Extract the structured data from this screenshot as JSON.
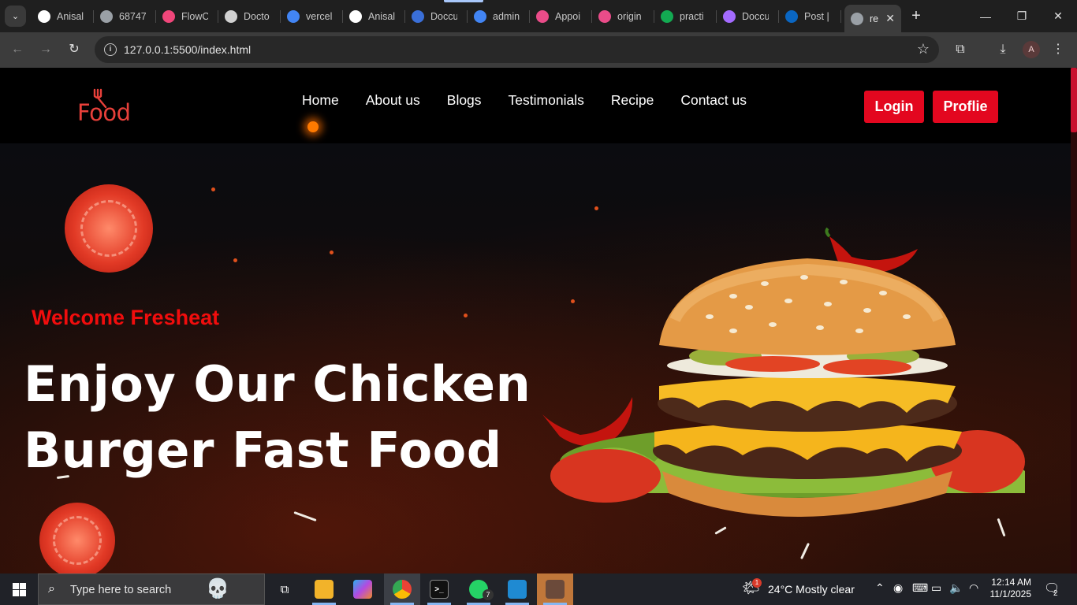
{
  "browser": {
    "tabs": [
      {
        "title": "Anisal",
        "icon": "github-icon",
        "color": "#ffffff"
      },
      {
        "title": "68747",
        "icon": "globe-icon",
        "color": "#9aa0a6"
      },
      {
        "title": "FlowC",
        "icon": "flowcv-icon",
        "color": "#f0467a"
      },
      {
        "title": "Docto",
        "icon": "chatgpt-icon",
        "color": "#d0d0d0"
      },
      {
        "title": "vercel",
        "icon": "google-icon",
        "color": "#4285f4"
      },
      {
        "title": "Anisal",
        "icon": "github-icon",
        "color": "#ffffff"
      },
      {
        "title": "Doccu",
        "icon": "doccure-icon",
        "color": "#3a6fd8"
      },
      {
        "title": "admin",
        "icon": "google-icon",
        "color": "#4285f4"
      },
      {
        "title": "Appoi",
        "icon": "dribbble-icon",
        "color": "#ea4c89"
      },
      {
        "title": "origin",
        "icon": "dribbble-icon",
        "color": "#ea4c89"
      },
      {
        "title": "practi",
        "icon": "mongodb-icon",
        "color": "#13aa52"
      },
      {
        "title": "Doccu",
        "icon": "vite-icon",
        "color": "#a46bff"
      },
      {
        "title": "Post |",
        "icon": "linkedin-icon",
        "color": "#0a66c2"
      }
    ],
    "active_tab": {
      "title": "re",
      "icon": "globe-icon"
    },
    "url": "127.0.0.1:5500/index.html",
    "profile_initial": "A"
  },
  "site": {
    "logo": "Food",
    "nav": [
      "Home",
      "About us",
      "Blogs",
      "Testimonials",
      "Recipe",
      "Contact us"
    ],
    "login_label": "Login",
    "profile_label": "Proflie",
    "welcome": "Welcome Fresheat",
    "headline_line1": "Enjoy Our Chicken",
    "headline_line2": "Burger Fast Food",
    "accent_color": "#e3071f"
  },
  "taskbar": {
    "search_placeholder": "Type here to search",
    "whatsapp_badge": "7",
    "weather_badge": "1",
    "weather": "24°C  Mostly clear",
    "time": "12:14 AM",
    "date": "11/1/2025",
    "notifications": "2"
  }
}
